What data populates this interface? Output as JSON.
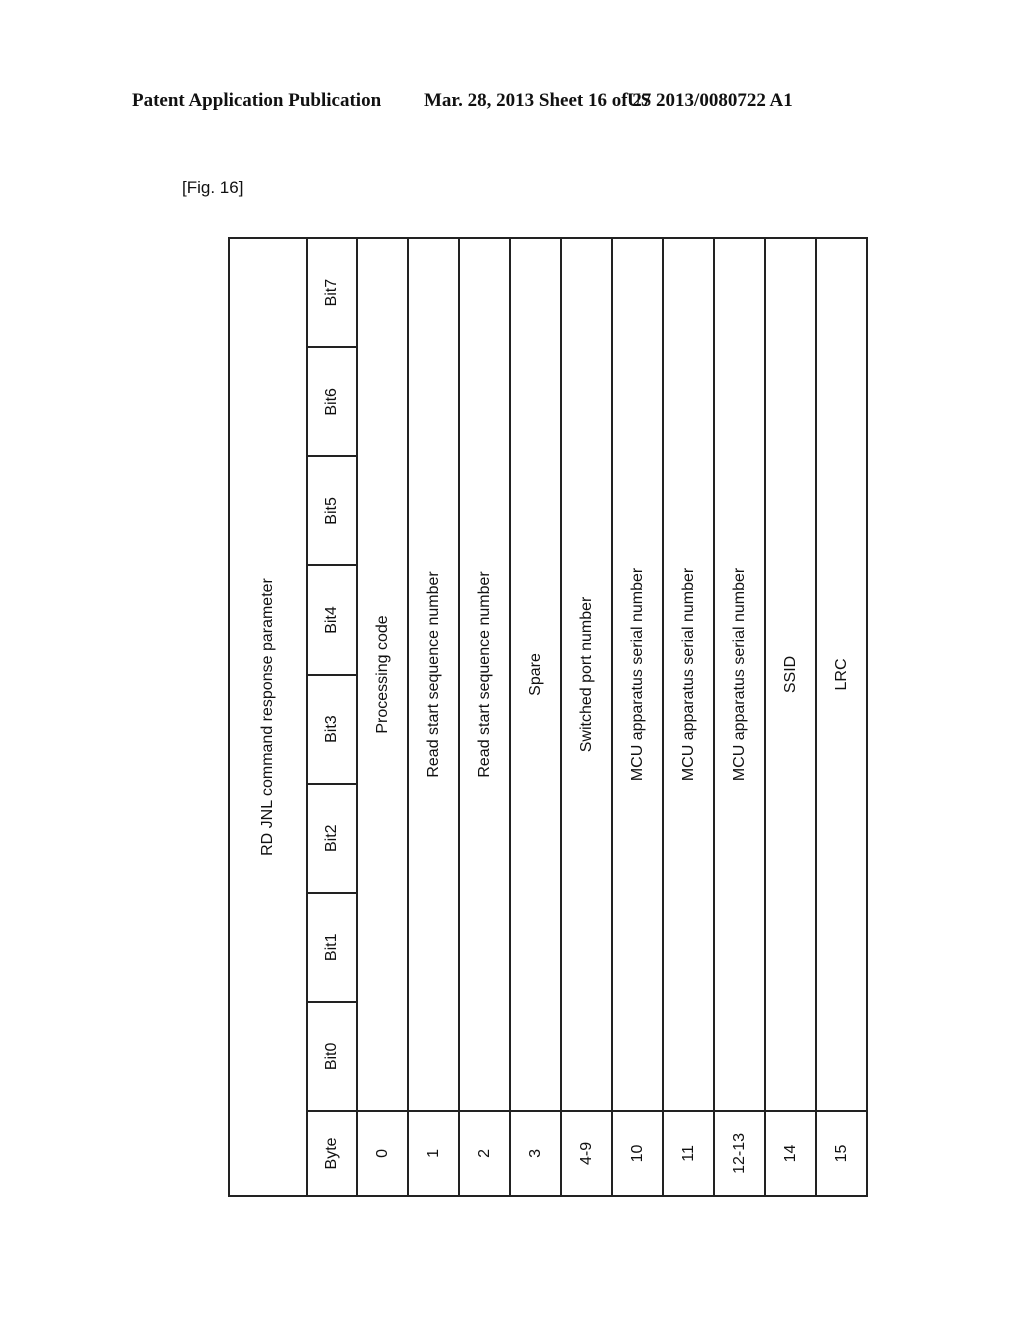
{
  "header": {
    "publication": "Patent Application Publication",
    "date_sheet": "Mar. 28, 2013  Sheet 16 of 27",
    "number": "US 2013/0080722 A1"
  },
  "figure_label": "[Fig. 16]",
  "table": {
    "title": "RD JNL command response parameter",
    "columns": [
      "Byte",
      "Bit0",
      "Bit1",
      "Bit2",
      "Bit3",
      "Bit4",
      "Bit5",
      "Bit6",
      "Bit7"
    ],
    "rows": [
      {
        "byte": "0",
        "content": "Processing code"
      },
      {
        "byte": "1",
        "content": "Read start sequence number"
      },
      {
        "byte": "2",
        "content": "Read start sequence number"
      },
      {
        "byte": "3",
        "content": "Spare"
      },
      {
        "byte": "4-9",
        "content": "Switched port number"
      },
      {
        "byte": "10",
        "content": "MCU apparatus serial number"
      },
      {
        "byte": "11",
        "content": "MCU apparatus serial number"
      },
      {
        "byte": "12-13",
        "content": "MCU apparatus serial number"
      },
      {
        "byte": "14",
        "content": "SSID"
      },
      {
        "byte": "15",
        "content": "LRC"
      }
    ]
  }
}
